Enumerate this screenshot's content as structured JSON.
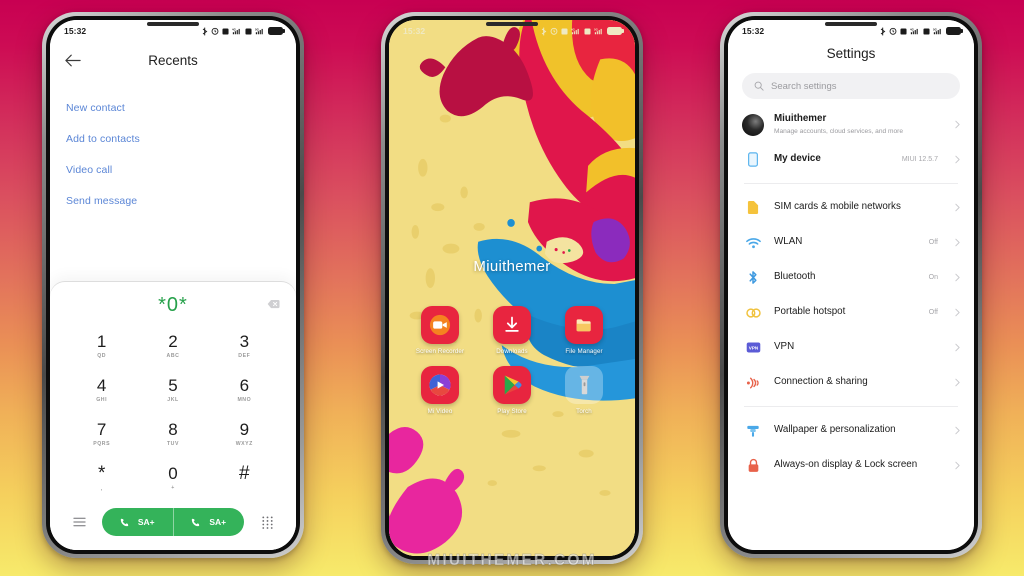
{
  "background": {
    "top_color": "#c80052",
    "bottom_color": "#f7ea6b"
  },
  "watermark": {
    "text": "MIUITHEMER.COM"
  },
  "status_bar": {
    "time": "15:32",
    "icons": [
      "bluetooth-icon",
      "alarm-icon",
      "sim1-4g-signal-icon",
      "sim2-5g-signal-icon",
      "battery-icon"
    ]
  },
  "phone1": {
    "screen_name": "dialer-recents",
    "header": {
      "back_icon": "back-arrow-icon",
      "title": "Recents"
    },
    "links": [
      {
        "label": "New contact"
      },
      {
        "label": "Add to contacts"
      },
      {
        "label": "Video call"
      },
      {
        "label": "Send message"
      }
    ],
    "dialpad": {
      "entered_number": "*0*",
      "number_color": "#27a14b",
      "delete_icon": "backspace-icon",
      "keys": [
        {
          "digit": "1",
          "letters": "QD"
        },
        {
          "digit": "2",
          "letters": "ABC"
        },
        {
          "digit": "3",
          "letters": "DEF"
        },
        {
          "digit": "4",
          "letters": "GHI"
        },
        {
          "digit": "5",
          "letters": "JKL"
        },
        {
          "digit": "6",
          "letters": "MNO"
        },
        {
          "digit": "7",
          "letters": "PQRS"
        },
        {
          "digit": "8",
          "letters": "TUV"
        },
        {
          "digit": "9",
          "letters": "WXYZ"
        },
        {
          "digit": "*",
          "letters": ","
        },
        {
          "digit": "0",
          "letters": "+"
        },
        {
          "digit": "#",
          "letters": ""
        }
      ],
      "bottom_bar": {
        "menu_icon": "hamburger-menu-icon",
        "keypad_icon": "keypad-grid-icon",
        "call_button_color": "#34b35a",
        "call_buttons": [
          {
            "icon": "phone-call-icon",
            "label": "SA+"
          },
          {
            "icon": "phone-call-icon",
            "label": "SA+"
          }
        ]
      }
    }
  },
  "phone2": {
    "screen_name": "home-screen",
    "clock_widget": {
      "text": "Miuithemer"
    },
    "apps": [
      {
        "label": "Screen Recorder",
        "icon": "screen-recorder-icon",
        "color": "#e8253f"
      },
      {
        "label": "Downloads",
        "icon": "download-arrow-icon",
        "color": "#e8253f"
      },
      {
        "label": "File Manager",
        "icon": "folder-icon",
        "color": "#e8253f"
      },
      {
        "label": "Mi Video",
        "icon": "mi-video-play-icon",
        "color": "#e8253f"
      },
      {
        "label": "Play Store",
        "icon": "play-store-icon",
        "color": "#e8253f"
      },
      {
        "label": "Torch",
        "icon": "flashlight-icon",
        "color": "rgba(255,255,255,0.30)"
      }
    ]
  },
  "phone3": {
    "screen_name": "settings",
    "title": "Settings",
    "search": {
      "placeholder": "Search settings",
      "icon": "search-icon"
    },
    "account": {
      "name": "Miuithemer",
      "subtitle": "Manage accounts, cloud services, and more",
      "avatar": "account-avatar"
    },
    "device": {
      "label": "My device",
      "value": "MIUI 12.5.7",
      "icon": "device-icon"
    },
    "items": [
      {
        "label": "SIM cards & mobile networks",
        "value": "",
        "icon": "sim-card-icon",
        "color": "#f5c33c"
      },
      {
        "label": "WLAN",
        "value": "Off",
        "icon": "wifi-icon",
        "color": "#4aa8e8"
      },
      {
        "label": "Bluetooth",
        "value": "On",
        "icon": "bluetooth-icon",
        "color": "#3f9ae0"
      },
      {
        "label": "Portable hotspot",
        "value": "Off",
        "icon": "hotspot-icon",
        "color": "#f0c23e"
      },
      {
        "label": "VPN",
        "value": "",
        "icon": "vpn-icon",
        "color": "#5b5bd6"
      },
      {
        "label": "Connection & sharing",
        "value": "",
        "icon": "connection-sharing-icon",
        "color": "#e8624a"
      }
    ],
    "items2": [
      {
        "label": "Wallpaper & personalization",
        "value": "",
        "icon": "paint-roller-icon",
        "color": "#4aa8e8"
      },
      {
        "label": "Always-on display & Lock screen",
        "value": "",
        "icon": "lock-icon",
        "color": "#e8624a"
      }
    ]
  }
}
